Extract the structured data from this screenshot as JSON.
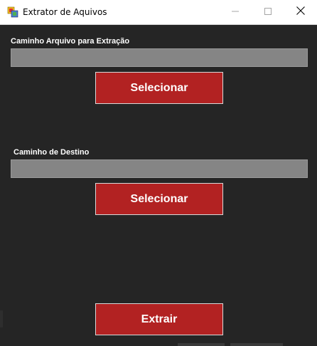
{
  "window": {
    "title": "Extrator de Aquivos",
    "app_icon": "app-icon",
    "controls": [
      "minimize-icon",
      "maximize-icon",
      "close-icon"
    ]
  },
  "source": {
    "label": "Caminho Arquivo para Extração",
    "value": "",
    "button_label": "Selecionar"
  },
  "destination": {
    "label": "Caminho de Destino",
    "value": "",
    "button_label": "Selecionar"
  },
  "actions": {
    "extract_label": "Extrair"
  },
  "colors": {
    "background": "#252525",
    "accent_button": "#b22222",
    "textbox": "#858585",
    "text": "#ffffff"
  }
}
